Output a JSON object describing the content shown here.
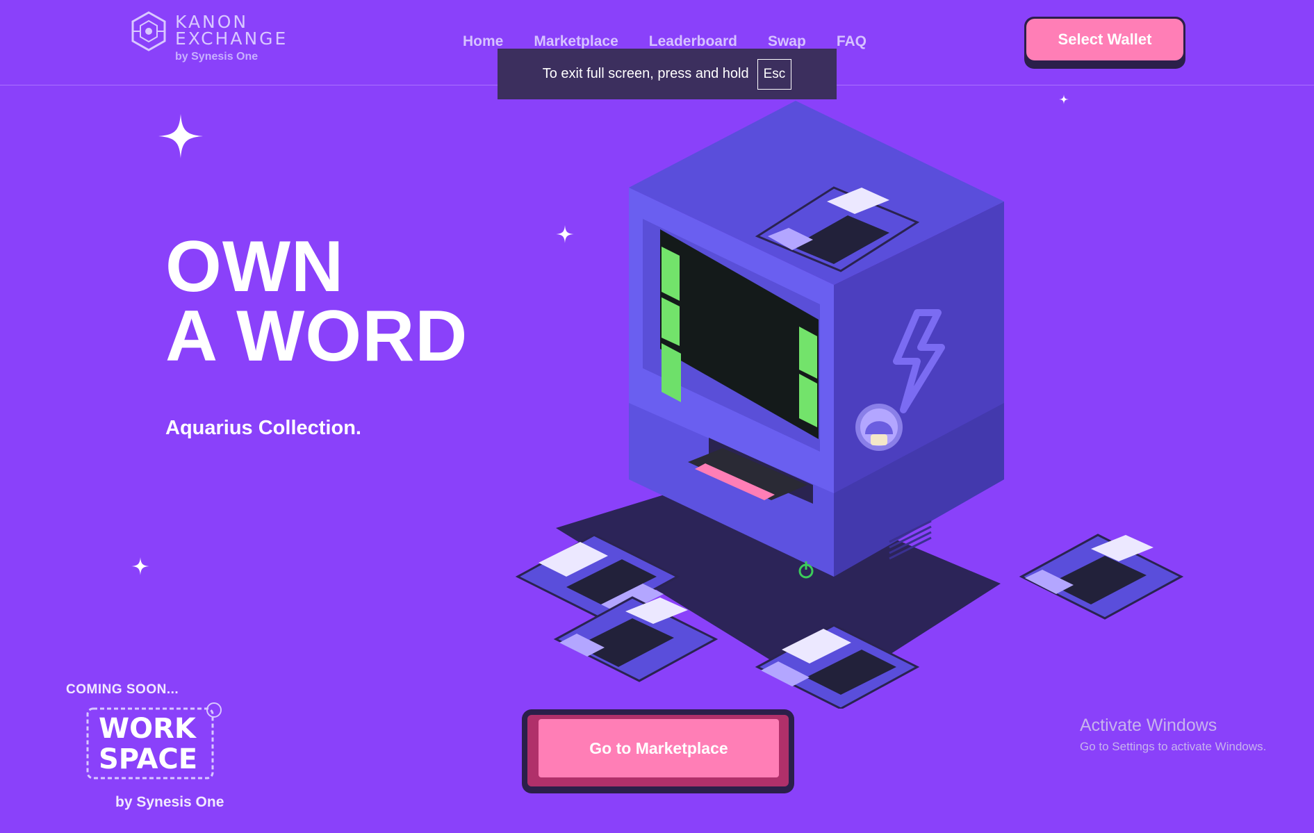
{
  "brand": {
    "title_line1": "KANON",
    "title_line2": "EXCHANGE",
    "subtitle": "by Synesis One"
  },
  "nav": {
    "items": [
      {
        "label": "Home"
      },
      {
        "label": "Marketplace"
      },
      {
        "label": "Leaderboard"
      },
      {
        "label": "Swap"
      },
      {
        "label": "FAQ"
      }
    ]
  },
  "wallet": {
    "label": "Select Wallet"
  },
  "fullscreen_toast": {
    "text": "To exit full screen, press and hold",
    "key": "Esc"
  },
  "hero": {
    "line1": "OWN",
    "line2": "A WORD",
    "subtitle": "Aquarius Collection."
  },
  "coming_soon": {
    "label": "COMING SOON...",
    "logo_line1": "WORK",
    "logo_line2": "SPACE",
    "by": "by Synesis One"
  },
  "cta": {
    "label": "Go to Marketplace"
  },
  "windows_watermark": {
    "title": "Activate Windows",
    "subtitle": "Go to Settings to activate Windows."
  },
  "colors": {
    "background": "#8a41fa",
    "accent_pink": "#ff7eb6",
    "dark": "#2b1f4a",
    "machine_purple": "#5b4ee0"
  },
  "icons": [
    "kanon-logo-icon",
    "sparkle-icon",
    "lightning-icon",
    "mushroom-sticker-icon",
    "floppy-disk-icon",
    "power-icon"
  ]
}
